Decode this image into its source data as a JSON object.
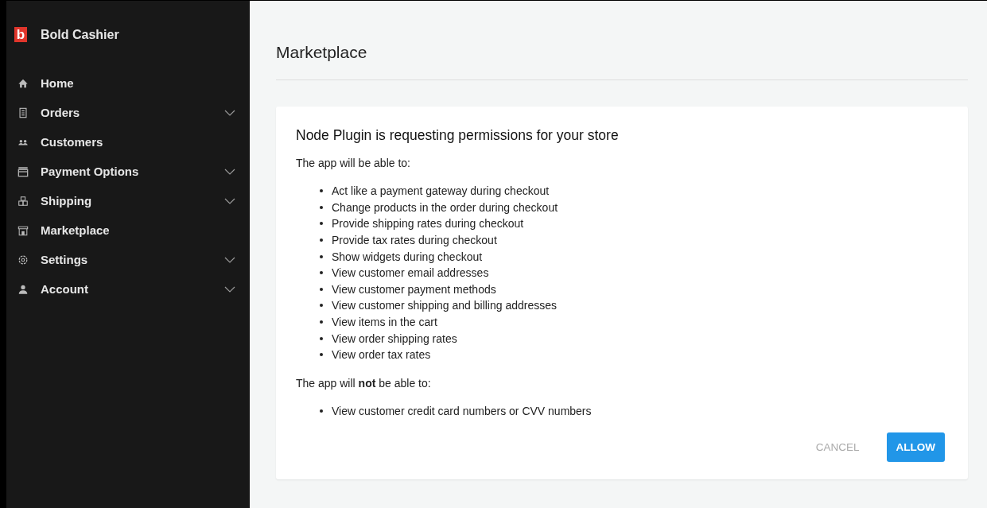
{
  "sidebar": {
    "brand": {
      "logo": "b",
      "name": "Bold Cashier"
    },
    "items": [
      {
        "kind": "home",
        "label": "Home",
        "expandable": false
      },
      {
        "kind": "orders",
        "label": "Orders",
        "expandable": true
      },
      {
        "kind": "customers",
        "label": "Customers",
        "expandable": false
      },
      {
        "kind": "payment",
        "label": "Payment Options",
        "expandable": true
      },
      {
        "kind": "shipping",
        "label": "Shipping",
        "expandable": true
      },
      {
        "kind": "marketplace",
        "label": "Marketplace",
        "expandable": false
      },
      {
        "kind": "settings",
        "label": "Settings",
        "expandable": true
      },
      {
        "kind": "account",
        "label": "Account",
        "expandable": true
      }
    ]
  },
  "page": {
    "title": "Marketplace"
  },
  "dialog": {
    "heading": "Node Plugin is requesting permissions for your store",
    "allowed_intro": "The app will be able to:",
    "allowed": [
      "Act like a payment gateway during checkout",
      "Change products in the order during checkout",
      "Provide shipping rates during checkout",
      "Provide tax rates during checkout",
      "Show widgets during checkout",
      "View customer email addresses",
      "View customer payment methods",
      "View customer shipping and billing addresses",
      "View items in the cart",
      "View order shipping rates",
      "View order tax rates"
    ],
    "denied_intro": "The app will **not** be able to:",
    "denied": [
      "View customer credit card numbers or CVV numbers"
    ],
    "buttons": [
      {
        "kind": "text",
        "label": "CANCEL"
      },
      {
        "kind": "primary",
        "label": "ALLOW"
      }
    ]
  }
}
